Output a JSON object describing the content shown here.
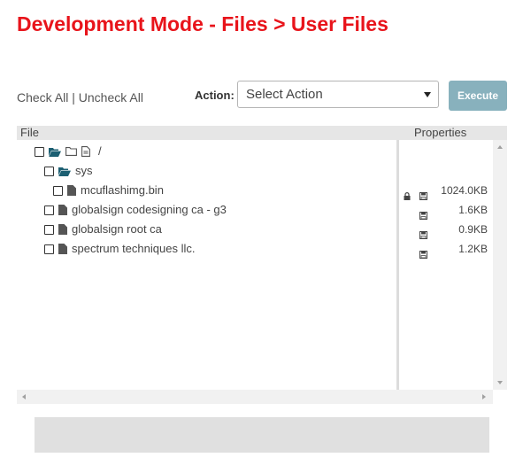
{
  "page": {
    "title": "Development Mode - Files > User Files"
  },
  "controls": {
    "check_all": "Check All",
    "separator": " | ",
    "uncheck_all": "Uncheck All",
    "action_label": "Action:",
    "action_selected": "Select Action",
    "execute_label": "Execute"
  },
  "table": {
    "header_file": "File",
    "header_properties": "Properties"
  },
  "tree": [
    {
      "name": "/",
      "type": "root"
    },
    {
      "name": "sys",
      "type": "folder"
    },
    {
      "name": "mcuflashimg.bin",
      "type": "file",
      "locked": true,
      "size": "1024.0KB"
    },
    {
      "name": "globalsign codesigning ca - g3",
      "type": "file",
      "locked": false,
      "size": "1.6KB"
    },
    {
      "name": "globalsign root ca",
      "type": "file",
      "locked": false,
      "size": "0.9KB"
    },
    {
      "name": "spectrum techniques llc.",
      "type": "file",
      "locked": false,
      "size": "1.2KB"
    }
  ],
  "colors": {
    "title": "#e8141b",
    "folder_icon": "#1c5f72",
    "execute_button": "#88b1bd"
  }
}
